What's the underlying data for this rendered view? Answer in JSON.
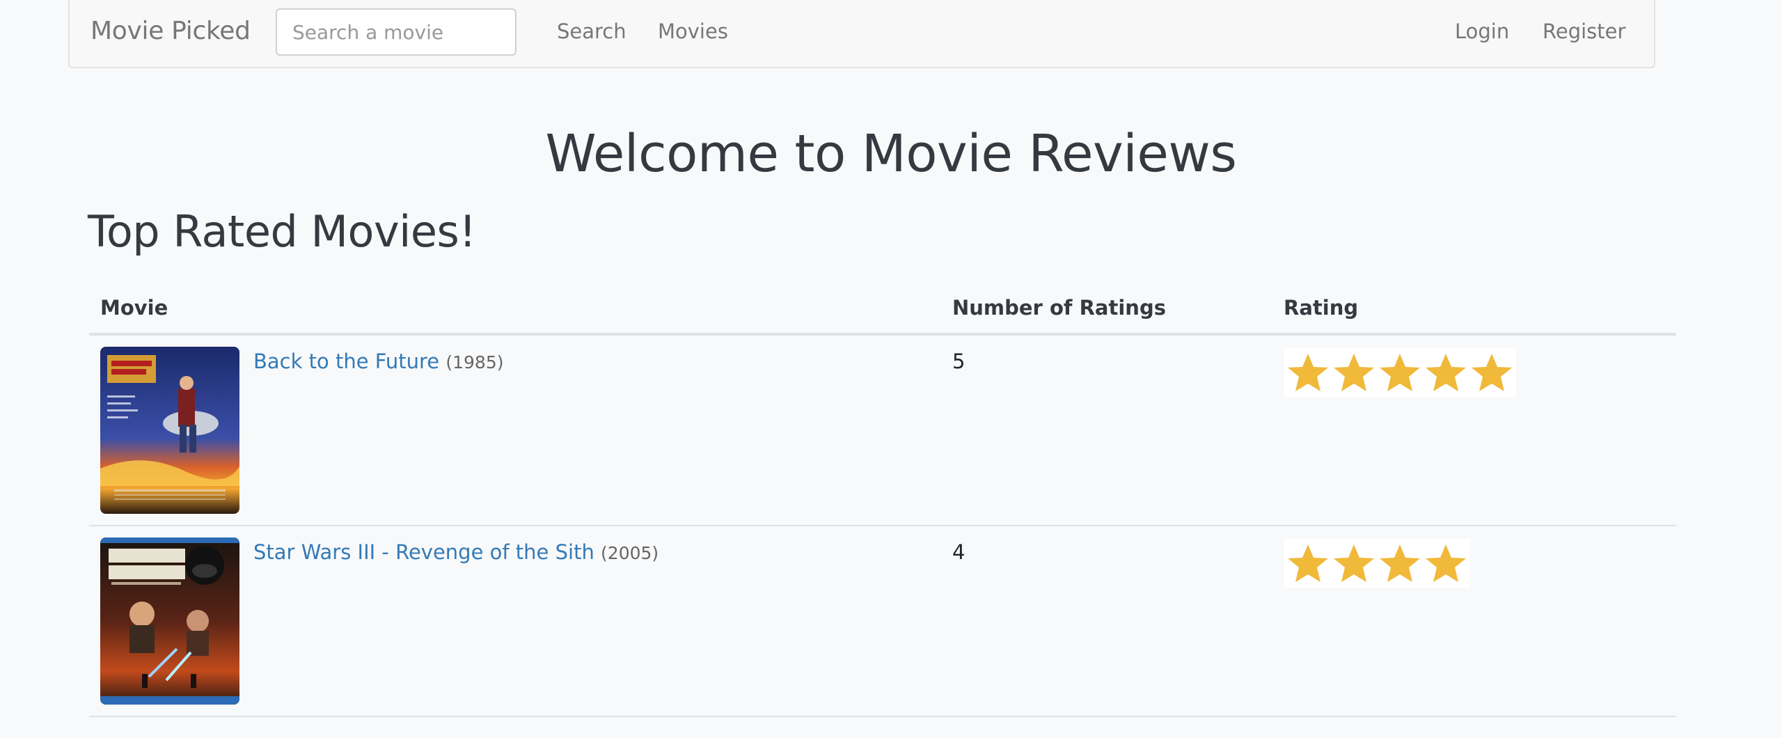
{
  "nav": {
    "brand": "Movie Picked",
    "search_placeholder": "Search a movie",
    "search_link": "Search",
    "movies_link": "Movies",
    "login_link": "Login",
    "register_link": "Register"
  },
  "page": {
    "title": "Welcome to Movie Reviews",
    "section_title": "Top Rated Movies!"
  },
  "table": {
    "headers": {
      "movie": "Movie",
      "count": "Number of Ratings",
      "rating": "Rating"
    },
    "rows": [
      {
        "title": "Back to the Future",
        "year": "(1985)",
        "num_ratings": "5",
        "stars": 5,
        "poster_icon": "back-to-the-future-poster"
      },
      {
        "title": "Star Wars III - Revenge of the Sith",
        "year": "(2005)",
        "num_ratings": "4",
        "stars": 4,
        "poster_icon": "star-wars-poster"
      }
    ]
  },
  "colors": {
    "link": "#337ab7",
    "star": "#f0b93a",
    "heading": "#343a40"
  }
}
